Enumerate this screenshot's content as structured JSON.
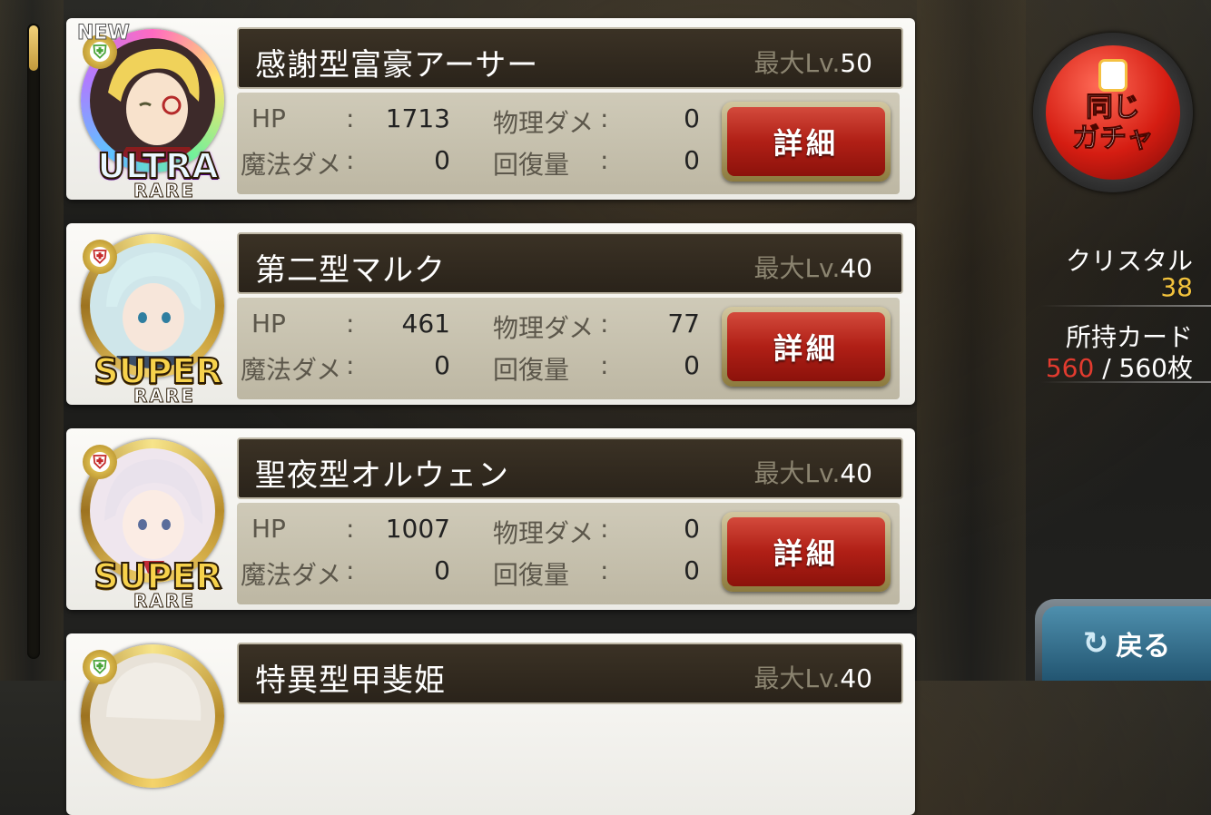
{
  "cards": [
    {
      "name": "感謝型富豪アーサー",
      "lv_prefix": "最大Lv.",
      "lv": "50",
      "rarity_top": "ULTRA",
      "rarity_bottom": "RARE",
      "new_label": "NEW",
      "hp_label": "HP",
      "hp": "1713",
      "phys_label": "物理ダメ",
      "phys": "0",
      "mag_label": "魔法ダメ",
      "mag": "0",
      "heal_label": "回復量",
      "heal": "0",
      "detail_label": "詳細"
    },
    {
      "name": "第二型マルク",
      "lv_prefix": "最大Lv.",
      "lv": "40",
      "rarity_top": "SUPER",
      "rarity_bottom": "RARE",
      "hp_label": "HP",
      "hp": "461",
      "phys_label": "物理ダメ",
      "phys": "77",
      "mag_label": "魔法ダメ",
      "mag": "0",
      "heal_label": "回復量",
      "heal": "0",
      "detail_label": "詳細"
    },
    {
      "name": "聖夜型オルウェン",
      "lv_prefix": "最大Lv.",
      "lv": "40",
      "rarity_top": "SUPER",
      "rarity_bottom": "RARE",
      "hp_label": "HP",
      "hp": "1007",
      "phys_label": "物理ダメ",
      "phys": "0",
      "mag_label": "魔法ダメ",
      "mag": "0",
      "heal_label": "回復量",
      "heal": "0",
      "detail_label": "詳細"
    },
    {
      "name": "特異型甲斐姫",
      "lv_prefix": "最大Lv.",
      "lv": "40"
    }
  ],
  "colon": ":",
  "side": {
    "gacha_line1": "同じ",
    "gacha_line2": "ガチャ",
    "crystal_label": "クリスタル",
    "crystal_value": "38",
    "cards_label": "所持カード",
    "cards_owned": "560",
    "cards_sep": " / ",
    "cards_max": "560枚",
    "back_label": "戻る"
  },
  "colors": {
    "detail_button": "#b01f16",
    "gacha_button": "#d51d12",
    "crystal_value": "#f2c23c",
    "cards_owned": "#e23b2f",
    "back_button": "#225571"
  }
}
